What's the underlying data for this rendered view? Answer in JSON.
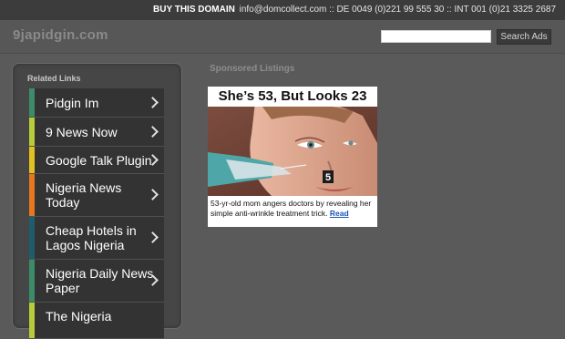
{
  "topbar": {
    "buy_label": "BUY THIS DOMAIN",
    "contact": "info@domcollect.com :: DE 0049 (0)221 99 555 30 :: INT 001 (0)21 3325 2687"
  },
  "header": {
    "logo": "9japidgin.com",
    "search": {
      "placeholder": "",
      "value": "",
      "button_label": "Search Ads"
    }
  },
  "sidebar": {
    "title": "Related Links",
    "links": [
      {
        "label": "Pidgin Im",
        "color": "#3c8c6a"
      },
      {
        "label": "9 News Now",
        "color": "#b8cc3a"
      },
      {
        "label": "Google Talk Plugin",
        "color": "#e2c21e"
      },
      {
        "label": "Nigeria News Today",
        "color": "#e8761e"
      },
      {
        "label": "Cheap Hotels in Lagos Nigeria",
        "color": "#1d5d6e"
      },
      {
        "label": "Nigeria Daily News Paper",
        "color": "#3c8c6a"
      },
      {
        "label": "The Nigeria",
        "color": "#b8cc3a"
      }
    ]
  },
  "main": {
    "title": "Sponsored Listings",
    "ad": {
      "headline": "She’s 53, But Looks 23",
      "caption": "53-yr-old mom angers doctors by revealing her simple anti-wrinkle treatment trick.",
      "read_label": "Read",
      "badge": "5"
    }
  }
}
